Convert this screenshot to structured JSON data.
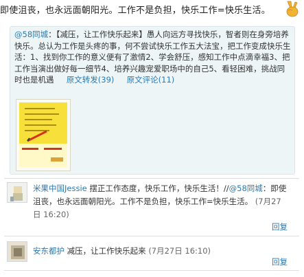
{
  "post": {
    "text": "即使沮丧，也永远面朝阳光。工作不是负担，快乐工作=快乐生活。",
    "icon": "victory-hand-icon"
  },
  "repost": {
    "user": "@58同城",
    "sep": "：",
    "body": "【减压，让工作快乐起来】愚人向远方寻找快乐，智者则在身旁培养快乐。总认为工作是头疼的事，何不尝试快乐工作五大法宝，把工作变成快乐生活：1、找到你工作的意义便有了激情2、学会舒压，感知工作中点滴幸福3、把工作当演出做好每一细节4、培养兴趣宠爱职场中的自己5、看轻困难，挑战同时也是机遇",
    "repost_label": "原文转发",
    "repost_count": "(39)",
    "comment_label": "原文评论",
    "comment_count": "(11)"
  },
  "comments": [
    {
      "user": "米果中国Jessie",
      "text": " 摆正工作态度，快乐工作，快乐生活！",
      "quote_sep": "//",
      "quote_user": "@58同城",
      "quote_text": "：即使沮丧，也永远面朝阳光。工作不是负担，快乐工作=快乐生活。",
      "time": " (7月27日 16:20)",
      "reply": "回复"
    },
    {
      "user": "安东都护",
      "text": " 减压，让工作快乐起来 ",
      "time": "(7月27日 16:10)",
      "reply": "回复"
    }
  ],
  "colors": {
    "link": "#2a7ab2",
    "repost_bg": "#eef5f6",
    "thumb_yellow": "#f7e03a"
  }
}
